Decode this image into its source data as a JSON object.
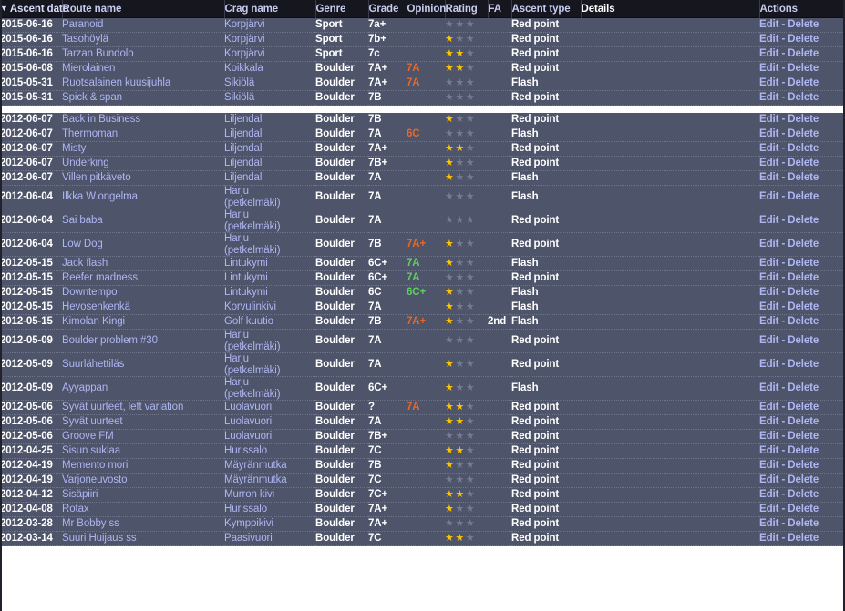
{
  "table": {
    "sort_indicator": "▼",
    "columns": [
      {
        "key": "ascent_date",
        "label": "Ascent date",
        "sorted": true
      },
      {
        "key": "route_name",
        "label": "Route name",
        "sorted": false
      },
      {
        "key": "crag_name",
        "label": "Crag name",
        "sorted": false
      },
      {
        "key": "genre",
        "label": "Genre",
        "sorted": false
      },
      {
        "key": "grade",
        "label": "Grade",
        "sorted": false
      },
      {
        "key": "opinion",
        "label": "Opinion",
        "sorted": false
      },
      {
        "key": "rating",
        "label": "Rating",
        "sorted": false
      },
      {
        "key": "fa",
        "label": "FA",
        "sorted": false
      },
      {
        "key": "ascent_type",
        "label": "Ascent type",
        "sorted": false
      },
      {
        "key": "details",
        "label": "Details",
        "sorted": false
      },
      {
        "key": "actions",
        "label": "Actions",
        "sorted": false
      }
    ],
    "actions": {
      "edit_label": "Edit",
      "separator": "-",
      "delete_label": "Delete"
    },
    "rows_top": [
      {
        "ascent_date": "2015-06-16",
        "route_name": "Paranoid",
        "crag_name": "Korpjärvi",
        "genre": "Sport",
        "grade": "7a+",
        "opinion": "",
        "opinion_dir": "",
        "rating": 0,
        "fa": "",
        "ascent_type": "Red point",
        "details": ""
      },
      {
        "ascent_date": "2015-06-16",
        "route_name": "Tasohöylä",
        "crag_name": "Korpjärvi",
        "genre": "Sport",
        "grade": "7b+",
        "opinion": "",
        "opinion_dir": "",
        "rating": 1,
        "fa": "",
        "ascent_type": "Red point",
        "details": ""
      },
      {
        "ascent_date": "2015-06-16",
        "route_name": "Tarzan Bundolo",
        "crag_name": "Korpjärvi",
        "genre": "Sport",
        "grade": "7c",
        "opinion": "",
        "opinion_dir": "",
        "rating": 2,
        "fa": "",
        "ascent_type": "Red point",
        "details": ""
      },
      {
        "ascent_date": "2015-06-08",
        "route_name": "Mierolainen",
        "crag_name": "Koikkala",
        "genre": "Boulder",
        "grade": "7A+",
        "opinion": "7A",
        "opinion_dir": "harder",
        "rating": 2,
        "fa": "",
        "ascent_type": "Red point",
        "details": ""
      },
      {
        "ascent_date": "2015-05-31",
        "route_name": "Ruotsalainen kuusijuhla",
        "crag_name": "Sikiölä",
        "genre": "Boulder",
        "grade": "7A+",
        "opinion": "7A",
        "opinion_dir": "harder",
        "rating": 0,
        "fa": "",
        "ascent_type": "Flash",
        "details": ""
      },
      {
        "ascent_date": "2015-05-31",
        "route_name": "Spick & span",
        "crag_name": "Sikiölä",
        "genre": "Boulder",
        "grade": "7B",
        "opinion": "",
        "opinion_dir": "",
        "rating": 0,
        "fa": "",
        "ascent_type": "Red point",
        "details": ""
      }
    ],
    "rows_bottom": [
      {
        "ascent_date": "2012-06-07",
        "route_name": "Back in Business",
        "crag_name": "Liljendal",
        "genre": "Boulder",
        "grade": "7B",
        "opinion": "",
        "opinion_dir": "",
        "rating": 1,
        "fa": "",
        "ascent_type": "Red point",
        "details": ""
      },
      {
        "ascent_date": "2012-06-07",
        "route_name": "Thermoman",
        "crag_name": "Liljendal",
        "genre": "Boulder",
        "grade": "7A",
        "opinion": "6C",
        "opinion_dir": "harder",
        "rating": 0,
        "fa": "",
        "ascent_type": "Flash",
        "details": ""
      },
      {
        "ascent_date": "2012-06-07",
        "route_name": "Misty",
        "crag_name": "Liljendal",
        "genre": "Boulder",
        "grade": "7A+",
        "opinion": "",
        "opinion_dir": "",
        "rating": 2,
        "fa": "",
        "ascent_type": "Red point",
        "details": ""
      },
      {
        "ascent_date": "2012-06-07",
        "route_name": "Underking",
        "crag_name": "Liljendal",
        "genre": "Boulder",
        "grade": "7B+",
        "opinion": "",
        "opinion_dir": "",
        "rating": 1,
        "fa": "",
        "ascent_type": "Red point",
        "details": ""
      },
      {
        "ascent_date": "2012-06-07",
        "route_name": "Villen pitkäveto",
        "crag_name": "Liljendal",
        "genre": "Boulder",
        "grade": "7A",
        "opinion": "",
        "opinion_dir": "",
        "rating": 1,
        "fa": "",
        "ascent_type": "Flash",
        "details": ""
      },
      {
        "ascent_date": "2012-06-04",
        "route_name": "Ilkka W.ongelma",
        "crag_name": "Harju (petkelmäki)",
        "genre": "Boulder",
        "grade": "7A",
        "opinion": "",
        "opinion_dir": "",
        "rating": 0,
        "fa": "",
        "ascent_type": "Flash",
        "details": "",
        "tall": true
      },
      {
        "ascent_date": "2012-06-04",
        "route_name": "Sai baba",
        "crag_name": "Harju (petkelmäki)",
        "genre": "Boulder",
        "grade": "7A",
        "opinion": "",
        "opinion_dir": "",
        "rating": 0,
        "fa": "",
        "ascent_type": "Red point",
        "details": "",
        "tall": true
      },
      {
        "ascent_date": "2012-06-04",
        "route_name": "Low Dog",
        "crag_name": "Harju (petkelmäki)",
        "genre": "Boulder",
        "grade": "7B",
        "opinion": "7A+",
        "opinion_dir": "harder",
        "rating": 1,
        "fa": "",
        "ascent_type": "Red point",
        "details": "",
        "tall": true
      },
      {
        "ascent_date": "2012-05-15",
        "route_name": "Jack flash",
        "crag_name": "Lintukymi",
        "genre": "Boulder",
        "grade": "6C+",
        "opinion": "7A",
        "opinion_dir": "easier",
        "rating": 1,
        "fa": "",
        "ascent_type": "Flash",
        "details": ""
      },
      {
        "ascent_date": "2012-05-15",
        "route_name": "Reefer madness",
        "crag_name": "Lintukymi",
        "genre": "Boulder",
        "grade": "6C+",
        "opinion": "7A",
        "opinion_dir": "easier",
        "rating": 0,
        "fa": "",
        "ascent_type": "Red point",
        "details": ""
      },
      {
        "ascent_date": "2012-05-15",
        "route_name": "Downtempo",
        "crag_name": "Lintukymi",
        "genre": "Boulder",
        "grade": "6C",
        "opinion": "6C+",
        "opinion_dir": "easier",
        "rating": 1,
        "fa": "",
        "ascent_type": "Flash",
        "details": ""
      },
      {
        "ascent_date": "2012-05-15",
        "route_name": "Hevosenkenkä",
        "crag_name": "Korvulinkivi",
        "genre": "Boulder",
        "grade": "7A",
        "opinion": "",
        "opinion_dir": "",
        "rating": 1,
        "fa": "",
        "ascent_type": "Flash",
        "details": ""
      },
      {
        "ascent_date": "2012-05-15",
        "route_name": "Kimolan Kingi",
        "crag_name": "Golf kuutio",
        "genre": "Boulder",
        "grade": "7B",
        "opinion": "7A+",
        "opinion_dir": "harder",
        "rating": 1,
        "fa": "2nd",
        "ascent_type": "Flash",
        "details": ""
      },
      {
        "ascent_date": "2012-05-09",
        "route_name": "Boulder problem #30",
        "crag_name": "Harju (petkelmäki)",
        "genre": "Boulder",
        "grade": "7A",
        "opinion": "",
        "opinion_dir": "",
        "rating": 0,
        "fa": "",
        "ascent_type": "Red point",
        "details": "",
        "tall": true
      },
      {
        "ascent_date": "2012-05-09",
        "route_name": "Suurlähettiläs",
        "crag_name": "Harju (petkelmäki)",
        "genre": "Boulder",
        "grade": "7A",
        "opinion": "",
        "opinion_dir": "",
        "rating": 1,
        "fa": "",
        "ascent_type": "Red point",
        "details": "",
        "tall": true
      },
      {
        "ascent_date": "2012-05-09",
        "route_name": "Ayyappan",
        "crag_name": "Harju (petkelmäki)",
        "genre": "Boulder",
        "grade": "6C+",
        "opinion": "",
        "opinion_dir": "",
        "rating": 1,
        "fa": "",
        "ascent_type": "Flash",
        "details": "",
        "tall": true
      },
      {
        "ascent_date": "2012-05-06",
        "route_name": "Syvät uurteet, left variation",
        "crag_name": "Luolavuori",
        "genre": "Boulder",
        "grade": "?",
        "opinion": "7A",
        "opinion_dir": "harder",
        "rating": 2,
        "fa": "",
        "ascent_type": "Red point",
        "details": ""
      },
      {
        "ascent_date": "2012-05-06",
        "route_name": "Syvät uurteet",
        "crag_name": "Luolavuori",
        "genre": "Boulder",
        "grade": "7A",
        "opinion": "",
        "opinion_dir": "",
        "rating": 2,
        "fa": "",
        "ascent_type": "Red point",
        "details": ""
      },
      {
        "ascent_date": "2012-05-06",
        "route_name": "Groove FM",
        "crag_name": "Luolavuori",
        "genre": "Boulder",
        "grade": "7B+",
        "opinion": "",
        "opinion_dir": "",
        "rating": 0,
        "fa": "",
        "ascent_type": "Red point",
        "details": ""
      },
      {
        "ascent_date": "2012-04-25",
        "route_name": "Sisun suklaa",
        "crag_name": "Hurissalo",
        "genre": "Boulder",
        "grade": "7C",
        "opinion": "",
        "opinion_dir": "",
        "rating": 2,
        "fa": "",
        "ascent_type": "Red point",
        "details": ""
      },
      {
        "ascent_date": "2012-04-19",
        "route_name": "Memento mori",
        "crag_name": "Mäyränmutka",
        "genre": "Boulder",
        "grade": "7B",
        "opinion": "",
        "opinion_dir": "",
        "rating": 1,
        "fa": "",
        "ascent_type": "Red point",
        "details": ""
      },
      {
        "ascent_date": "2012-04-19",
        "route_name": "Varjoneuvosto",
        "crag_name": "Mäyränmutka",
        "genre": "Boulder",
        "grade": "7C",
        "opinion": "",
        "opinion_dir": "",
        "rating": 0,
        "fa": "",
        "ascent_type": "Red point",
        "details": ""
      },
      {
        "ascent_date": "2012-04-12",
        "route_name": "Sisäpiiri",
        "crag_name": "Murron kivi",
        "genre": "Boulder",
        "grade": "7C+",
        "opinion": "",
        "opinion_dir": "",
        "rating": 2,
        "fa": "",
        "ascent_type": "Red point",
        "details": ""
      },
      {
        "ascent_date": "2012-04-08",
        "route_name": "Rotax",
        "crag_name": "Hurissalo",
        "genre": "Boulder",
        "grade": "7A+",
        "opinion": "",
        "opinion_dir": "",
        "rating": 1,
        "fa": "",
        "ascent_type": "Red point",
        "details": ""
      },
      {
        "ascent_date": "2012-03-28",
        "route_name": "Mr Bobby ss",
        "crag_name": "Kymppikivi",
        "genre": "Boulder",
        "grade": "7A+",
        "opinion": "",
        "opinion_dir": "",
        "rating": 0,
        "fa": "",
        "ascent_type": "Red point",
        "details": ""
      },
      {
        "ascent_date": "2012-03-14",
        "route_name": "Suuri Huijaus ss",
        "crag_name": "Paasivuori",
        "genre": "Boulder",
        "grade": "7C",
        "opinion": "",
        "opinion_dir": "",
        "rating": 2,
        "fa": "",
        "ascent_type": "Red point",
        "details": ""
      }
    ],
    "colors": {
      "header_bg": "#16161e",
      "header_text": "#c6ccf0",
      "row_bg": "#4e546a",
      "link": "#aeb6f2",
      "star_on": "#ffc400",
      "star_off": "#767c92",
      "opinion_harder": "#e8682a",
      "opinion_easier": "#5fcf5f"
    }
  }
}
